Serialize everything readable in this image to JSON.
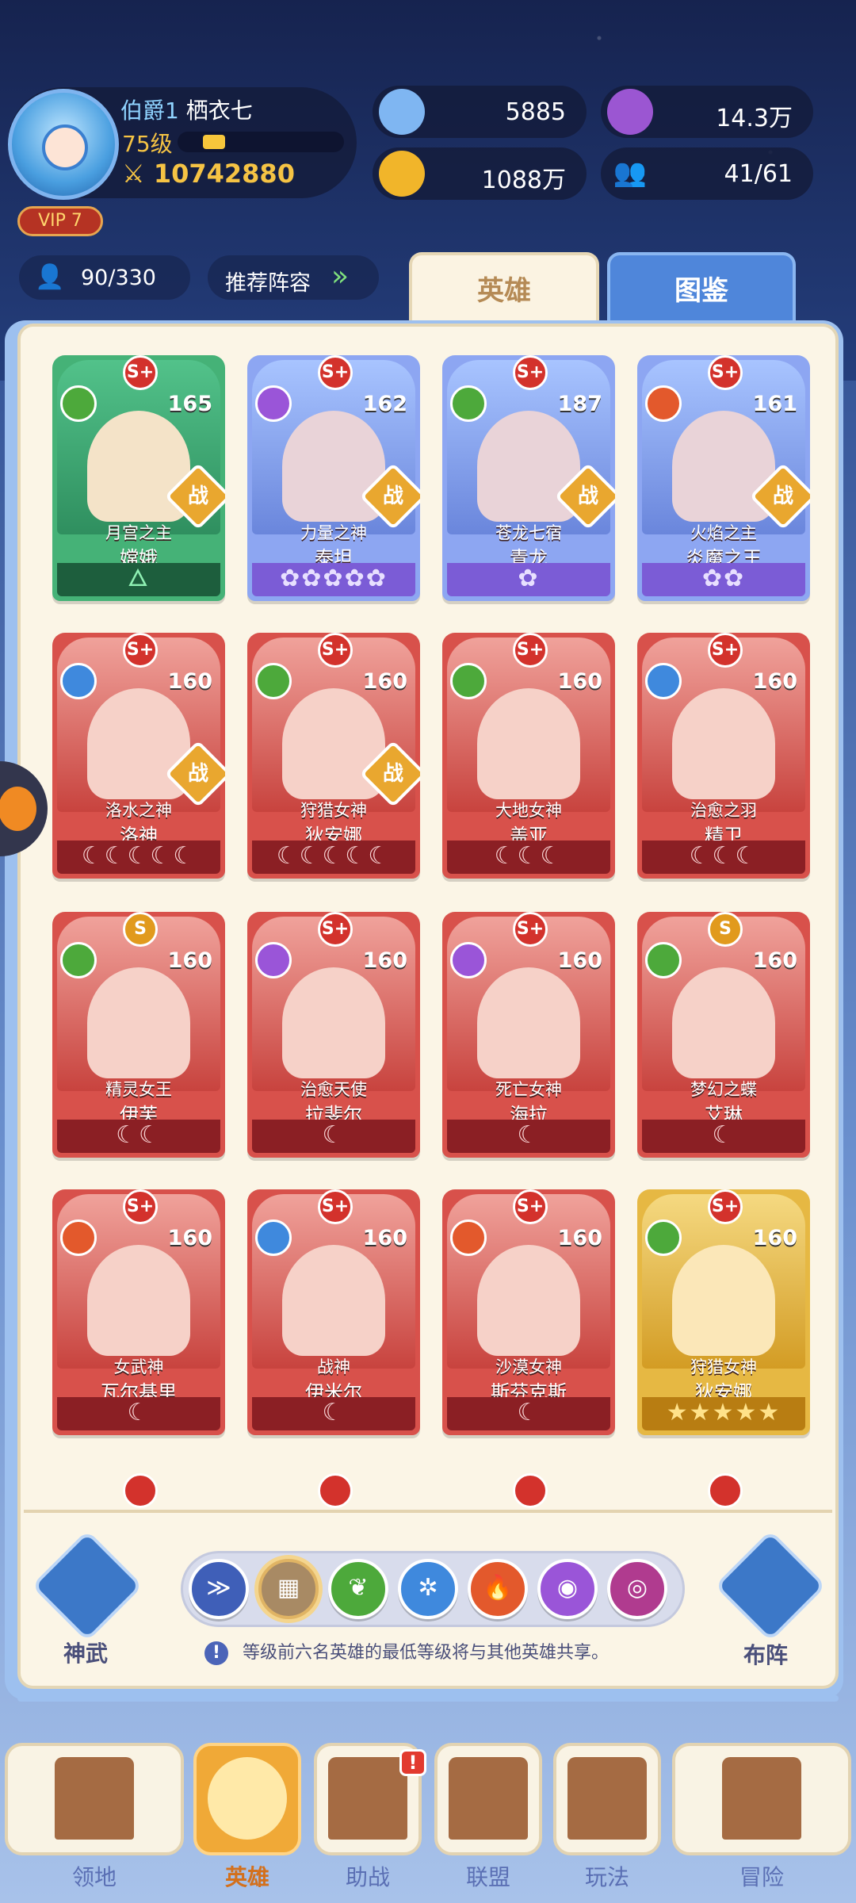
{
  "profile": {
    "rank": "伯爵1",
    "name": "栖衣七",
    "level": "75级",
    "power": "10742880",
    "vip": "VIP 7"
  },
  "resources": {
    "diamond": "5885",
    "purple_coin": "14.3万",
    "gold": "1088万",
    "friends": "41/61"
  },
  "subbar": {
    "hero_count": "90/330",
    "recommend": "推荐阵容"
  },
  "tabs": {
    "heroes": "英雄",
    "codex": "图鉴"
  },
  "heroes": [
    {
      "grade": "S+",
      "level": "165",
      "title": "月宫之主",
      "name": "嫦娥",
      "stars": "🜂",
      "theme": "green",
      "element": "wood",
      "battle": "战"
    },
    {
      "grade": "S+",
      "level": "162",
      "title": "力量之神",
      "name": "泰坦",
      "stars": "✿✿✿✿✿",
      "theme": "blue",
      "element": "light",
      "battle": "战"
    },
    {
      "grade": "S+",
      "level": "187",
      "title": "苍龙七宿",
      "name": "青龙",
      "stars": "✿",
      "theme": "blue",
      "element": "wood",
      "battle": "战"
    },
    {
      "grade": "S+",
      "level": "161",
      "title": "火焰之主",
      "name": "炎魔之王",
      "stars": "✿✿",
      "theme": "blue",
      "element": "fire",
      "battle": "战"
    },
    {
      "grade": "S+",
      "level": "160",
      "title": "洛水之神",
      "name": "洛神",
      "stars": "☾☾☾☾☾",
      "theme": "red",
      "element": "water",
      "battle": "战"
    },
    {
      "grade": "S+",
      "level": "160",
      "title": "狩猎女神",
      "name": "狄安娜",
      "stars": "☾☾☾☾☾",
      "theme": "red",
      "element": "wood",
      "battle": "战"
    },
    {
      "grade": "S+",
      "level": "160",
      "title": "大地女神",
      "name": "盖亚",
      "stars": "☾☾☾",
      "theme": "red",
      "element": "wood",
      "battle": ""
    },
    {
      "grade": "S+",
      "level": "160",
      "title": "治愈之羽",
      "name": "精卫",
      "stars": "☾☾☾",
      "theme": "red",
      "element": "water",
      "battle": ""
    },
    {
      "grade": "S",
      "level": "160",
      "title": "精灵女王",
      "name": "伊芙",
      "stars": "☾☾",
      "theme": "red",
      "element": "wood",
      "battle": ""
    },
    {
      "grade": "S+",
      "level": "160",
      "title": "治愈天使",
      "name": "拉斐尔",
      "stars": "☾",
      "theme": "red",
      "element": "light",
      "battle": ""
    },
    {
      "grade": "S+",
      "level": "160",
      "title": "死亡女神",
      "name": "海拉",
      "stars": "☾",
      "theme": "red",
      "element": "light",
      "battle": ""
    },
    {
      "grade": "S",
      "level": "160",
      "title": "梦幻之蝶",
      "name": "艾琳",
      "stars": "☾",
      "theme": "red",
      "element": "wood",
      "battle": ""
    },
    {
      "grade": "S+",
      "level": "160",
      "title": "女武神",
      "name": "瓦尔基里",
      "stars": "☾",
      "theme": "red",
      "element": "fire",
      "battle": ""
    },
    {
      "grade": "S+",
      "level": "160",
      "title": "战神",
      "name": "伊米尔",
      "stars": "☾",
      "theme": "red",
      "element": "water",
      "battle": ""
    },
    {
      "grade": "S+",
      "level": "160",
      "title": "沙漠女神",
      "name": "斯芬克斯",
      "stars": "☾",
      "theme": "red",
      "element": "fire",
      "battle": ""
    },
    {
      "grade": "S+",
      "level": "160",
      "title": "狩猎女神",
      "name": "狄安娜",
      "stars": "★★★★★",
      "theme": "gold",
      "element": "wood",
      "battle": ""
    }
  ],
  "controls": {
    "shenwu": "神武",
    "buzhen": "布阵",
    "notice": "等级前六名英雄的最低等级将与其他英雄共享。",
    "filters": [
      "≫",
      "▦",
      "❦",
      "✲",
      "🔥",
      "◉",
      "◎"
    ]
  },
  "nav": [
    "领地",
    "英雄",
    "助战",
    "联盟",
    "玩法",
    "冒险"
  ],
  "nav_badge": "!"
}
